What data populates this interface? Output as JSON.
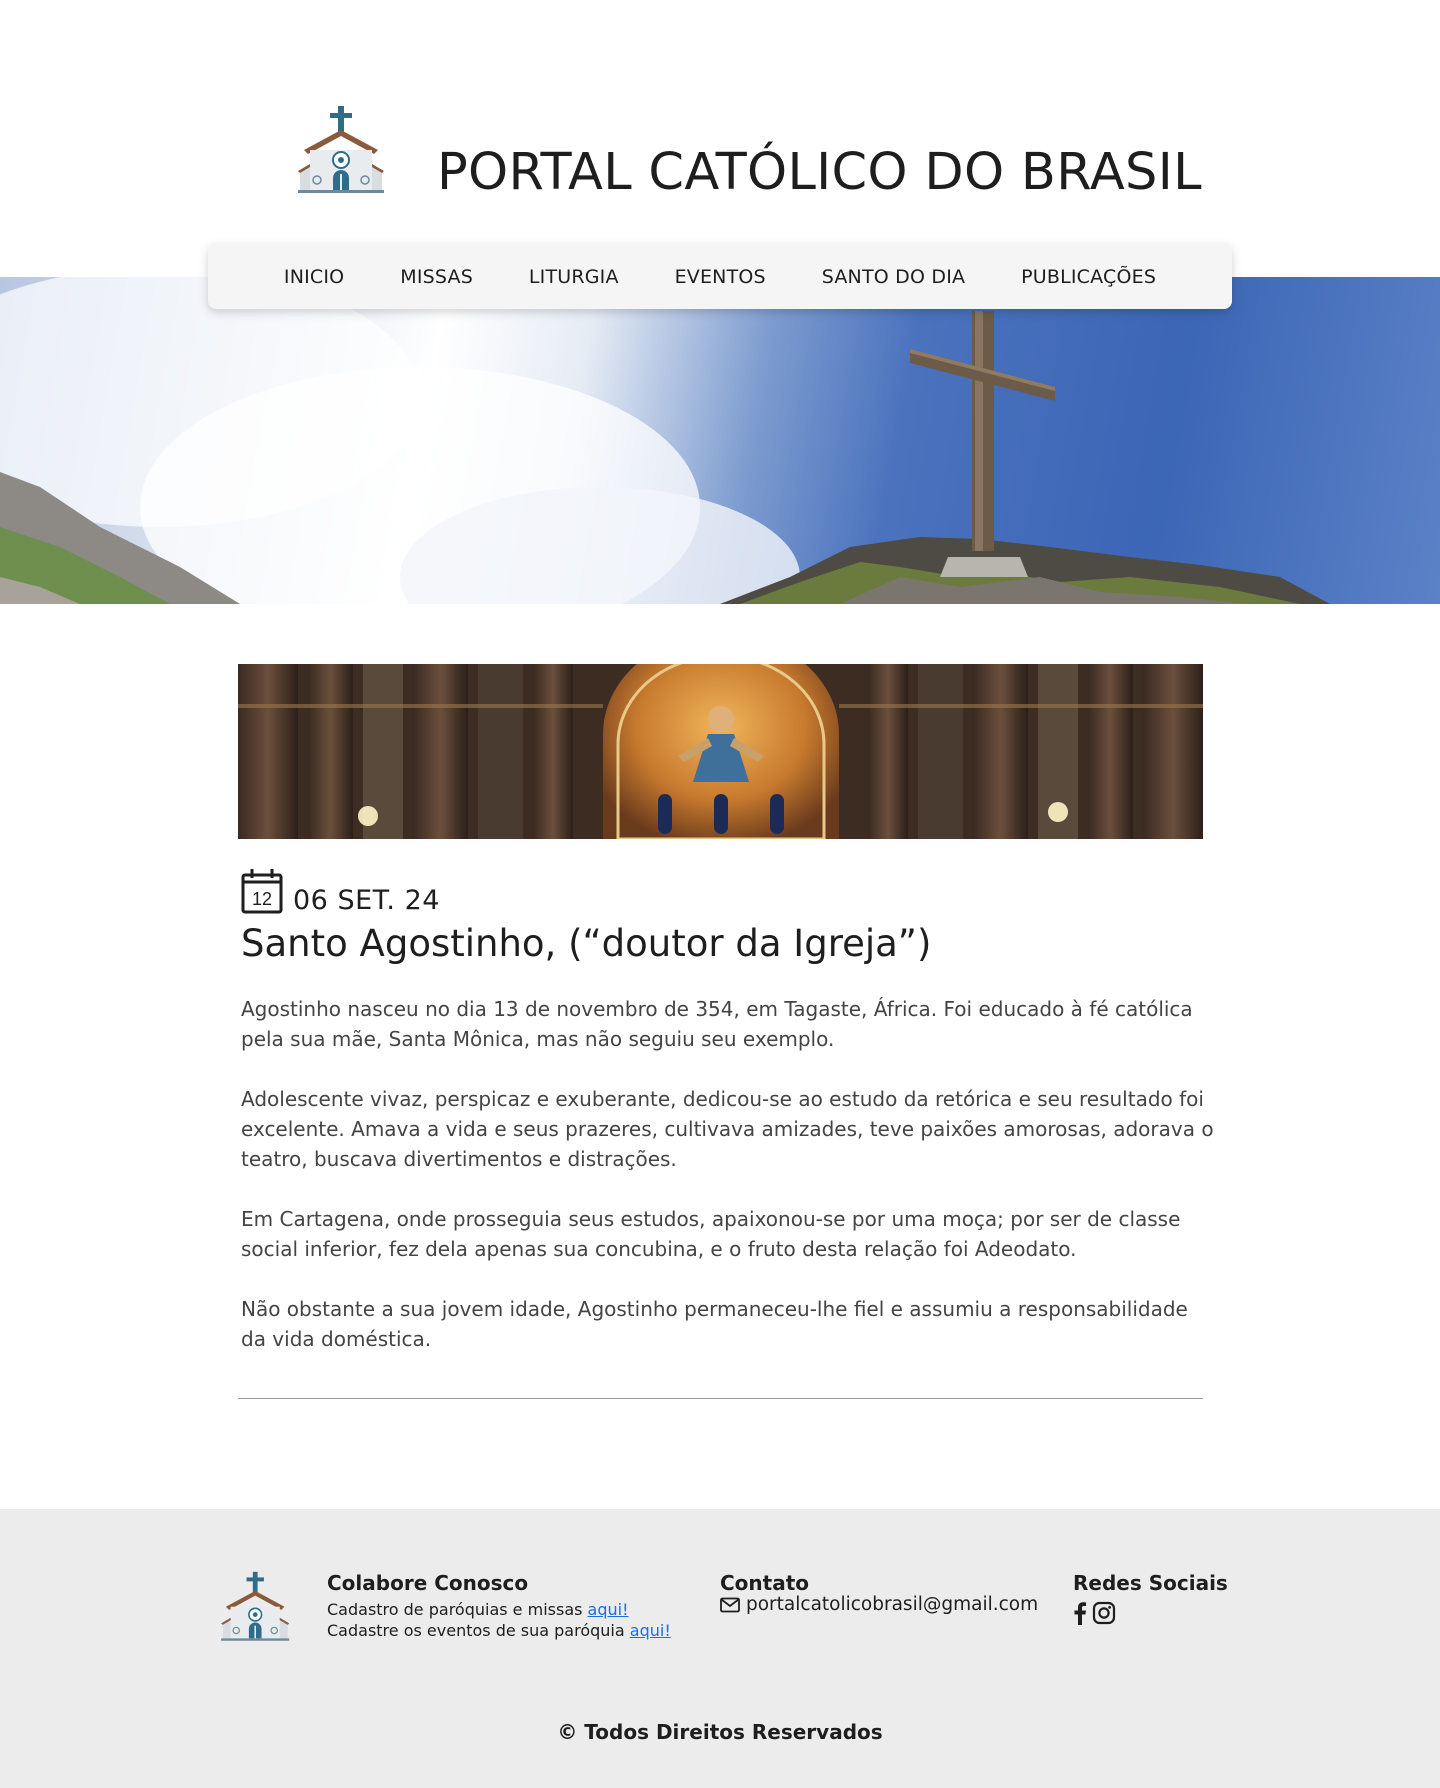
{
  "header": {
    "title": "PORTAL CATÓLICO DO BRASIL",
    "logo_icon": "church-icon"
  },
  "nav": {
    "items": [
      {
        "label": "INICIO"
      },
      {
        "label": "MISSAS"
      },
      {
        "label": "LITURGIA"
      },
      {
        "label": "EVENTOS"
      },
      {
        "label": "SANTO DO DIA"
      },
      {
        "label": "PUBLICAÇÕES"
      }
    ]
  },
  "article": {
    "calendar_day": "12",
    "date": "06 SET. 24",
    "title": "Santo Agostinho, (“doutor da Igreja”)",
    "paragraphs": [
      "Agostinho nasceu no dia 13 de novembro de 354, em Tagaste, África. Foi educado à fé católica pela sua mãe, Santa Mônica, mas não seguiu seu exemplo.",
      "Adolescente vivaz, perspicaz e exuberante, dedicou-se ao estudo da retórica e seu resultado foi excelente. Amava a vida e seus prazeres, cultivava amizades, teve paixões amorosas, adorava o teatro, buscava divertimentos e distrações.",
      "Em Cartagena, onde prosseguia seus estudos, apaixonou-se por uma moça; por ser de classe social inferior, fez dela apenas sua concubina, e o fruto desta relação foi Adeodato.",
      "Não obstante a sua jovem idade, Agostinho permaneceu-lhe fiel e assumiu a responsabilidade da vida doméstica."
    ]
  },
  "footer": {
    "collab": {
      "title": "Colabore Conosco",
      "line1_text": "Cadastro de paróquias e missas ",
      "line1_link": "aqui!",
      "line2_text": "Cadastre os eventos de sua paróquia ",
      "line2_link": "aqui!"
    },
    "contact": {
      "title": "Contato",
      "email": "portalcatolicobrasil@gmail.com"
    },
    "social": {
      "title": "Redes Sociais",
      "icons": [
        "facebook-icon",
        "instagram-icon"
      ]
    },
    "copyright": "© Todos Direitos Reservados"
  },
  "colors": {
    "link": "#1a6fe0",
    "footer_bg": "#ececed",
    "nav_bg": "#f5f5f5",
    "sky": "#3c66b6"
  }
}
